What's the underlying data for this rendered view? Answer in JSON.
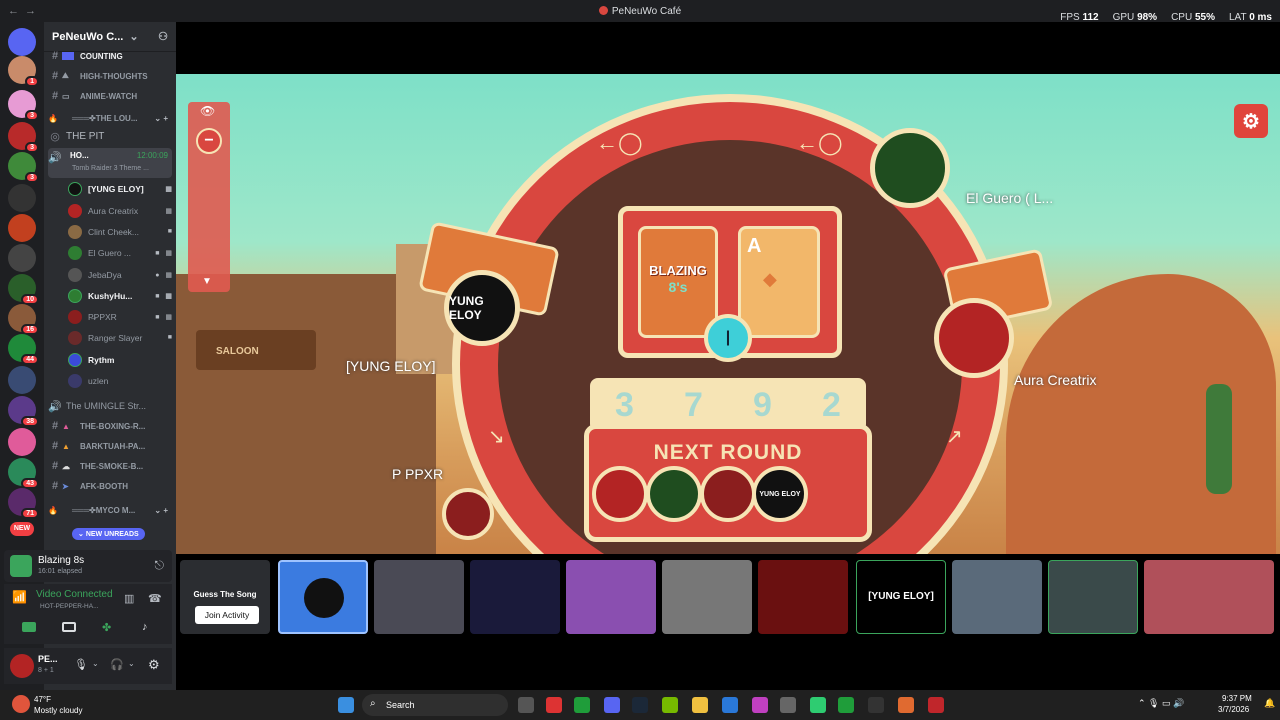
{
  "titlebar": {
    "nav": "←→",
    "title": "PeNeuWo Café",
    "fps_label": "FPS",
    "fps": "112",
    "gpu_label": "GPU",
    "gpu": "98%",
    "cpu_label": "CPU",
    "cpu": "55%",
    "lat_label": "LAT",
    "lat": "0 ms"
  },
  "server": {
    "name": "PeNeuWo C..."
  },
  "channels": [
    {
      "label": "COUNTING"
    },
    {
      "label": "HIGH-THOUGHTS"
    },
    {
      "label": "ANIME-WATCH"
    },
    {
      "label": "═══✜THE LOU..."
    },
    {
      "label": "THE PIT"
    },
    {
      "label": "HO...",
      "time": "12:00:09",
      "sub": "Tomb Raider 3 Theme ..."
    }
  ],
  "voice_users": [
    "[YUNG ELOY]",
    "Aura Creatrix",
    "Clint Cheek...",
    "El Guero ...",
    "JebaDya",
    "KushyHu...",
    "P̶PPXR",
    "Ranger Slayer",
    "Rythm",
    "uzlen"
  ],
  "channels2": [
    {
      "label": "The UMINGLE Str..."
    },
    {
      "label": "THE-BOXING-R..."
    },
    {
      "label": "BARKTUAH-PA..."
    },
    {
      "label": "THE-SMOKE-B..."
    },
    {
      "label": "AFK-BOOTH"
    },
    {
      "label": "═══✜MYCO M..."
    }
  ],
  "new_unreads": "NEW UNREADS",
  "new_badge": "NEW",
  "server_badges": [
    "1",
    "3",
    "3",
    "10",
    "16",
    "44",
    "38",
    "43",
    "71"
  ],
  "activity": {
    "title": "Blazing 8s",
    "elapsed": "16:01 elapsed"
  },
  "voice": {
    "status": "Video Connected",
    "channel": "HOT-PEPPER-HA..."
  },
  "user": {
    "name": "PE...",
    "tag": "8 + 1"
  },
  "game": {
    "deck_title": "BLAZING",
    "deck_sub": "8's",
    "top_card": "A",
    "next_round": "NEXT ROUND",
    "hand_cards": [
      "3",
      "7",
      "9",
      "2"
    ],
    "players": [
      {
        "name": "[YUNG ELOY]",
        "avatar_text": "YUNG ELOY"
      },
      {
        "name": "El Guero  ( L..."
      },
      {
        "name": "Aura Creatrix"
      },
      {
        "name": "P PPXR"
      }
    ],
    "round_avatars": [
      "",
      "",
      "",
      "YUNG ELOY"
    ],
    "saloon": "SALOON"
  },
  "strip": {
    "guess_title": "Guess The Song",
    "join_label": "Join Activity",
    "eloy_tile": "[YUNG ELOY]"
  },
  "taskbar": {
    "temp": "47°F",
    "weather": "Mostly cloudy",
    "search": "Search",
    "time": "9:37 PM",
    "date": "3/7/2026"
  },
  "colors": {
    "accent": "#5865f2",
    "danger": "#f23f43",
    "game_red": "#d9473f",
    "cream": "#f6e4b5"
  }
}
